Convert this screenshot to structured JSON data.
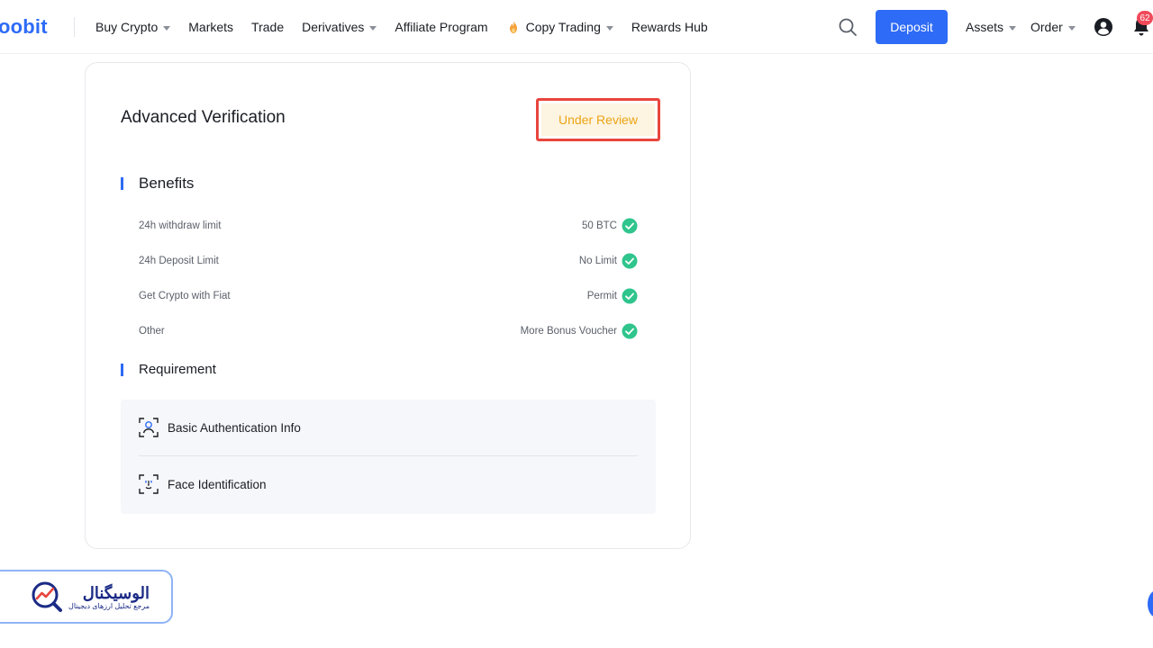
{
  "header": {
    "logo_text": "oobit",
    "nav": [
      {
        "label": "Buy Crypto",
        "has_dropdown": true
      },
      {
        "label": "Markets",
        "has_dropdown": false
      },
      {
        "label": "Trade",
        "has_dropdown": false
      },
      {
        "label": "Derivatives",
        "has_dropdown": true
      },
      {
        "label": "Affiliate Program",
        "has_dropdown": false
      },
      {
        "label": "Copy Trading",
        "has_dropdown": true,
        "icon": "flame-icon"
      },
      {
        "label": "Rewards Hub",
        "has_dropdown": false
      }
    ],
    "deposit_label": "Deposit",
    "assets_label": "Assets",
    "order_label": "Order",
    "notification_count": "62",
    "icons": [
      "search-icon",
      "user-icon",
      "bell-icon"
    ]
  },
  "card": {
    "title": "Advanced Verification",
    "status_label": "Under Review",
    "benefits_title": "Benefits",
    "benefits": [
      {
        "label": "24h withdraw limit",
        "value": "50 BTC"
      },
      {
        "label": "24h Deposit Limit",
        "value": "No Limit"
      },
      {
        "label": "Get Crypto with Fiat",
        "value": "Permit"
      },
      {
        "label": "Other",
        "value": "More Bonus Voucher"
      }
    ],
    "requirement_title": "Requirement",
    "requirements": [
      {
        "label": "Basic Authentication Info",
        "icon": "person-scan-icon"
      },
      {
        "label": "Face Identification",
        "icon": "face-scan-icon"
      }
    ]
  },
  "watermark": {
    "title": "الوسیگنال",
    "subtitle": "مرجع تحلیل ارزهای دیجیتال"
  },
  "colors": {
    "accent": "#2e6bf6",
    "status_text": "#eba414",
    "status_bg": "#fdf4e2",
    "highlight_border": "#e8453c",
    "check_green": "#2fc58c"
  }
}
